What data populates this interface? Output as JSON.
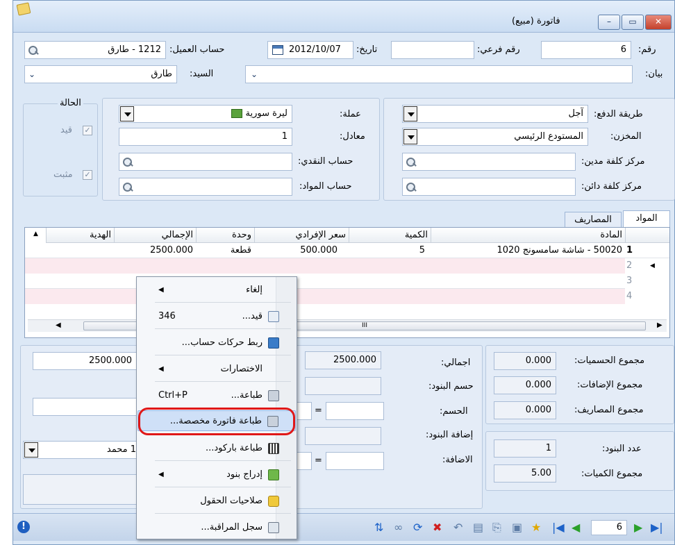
{
  "window": {
    "title": "فاتورة (مبيع)",
    "title_icon": "note-icon",
    "controls": [
      "minimize-icon",
      "restore-icon",
      "close-icon"
    ]
  },
  "header": {
    "number_label": "رقم:",
    "number_value": "6",
    "sub_number_label": "رقم فرعي:",
    "sub_number_value": "",
    "date_label": "تاريخ:",
    "date_value": "2012/10/07",
    "customer_label": "حساب العميل:",
    "customer_value": "1212 - طارق",
    "statement_label": "بيان:",
    "statement_value": "",
    "mr_label": "السيد:",
    "mr_value": "طارق"
  },
  "details": {
    "payment_label": "طريقة الدفع:",
    "payment_value": "آجل",
    "warehouse_label": "المخزن:",
    "warehouse_value": "المستودع الرئيسي",
    "debit_center_label": "مركز كلفة مدين:",
    "credit_center_label": "مركز كلفة دائن:",
    "currency_label": "عملة:",
    "currency_value": "ليرة سورية",
    "rate_label": "معادل:",
    "rate_value": "1",
    "cash_account_label": "حساب النقدي:",
    "materials_account_label": "حساب المواد:",
    "status_title": "الحالة",
    "status_posted": "قيد",
    "status_confirmed": "مثبت"
  },
  "tabs": [
    "المواد",
    "المصاريف"
  ],
  "grid": {
    "columns": [
      "المادة",
      "الكمية",
      "سعر الإفرادي",
      "وحدة",
      "الإجمالي",
      "الهدية"
    ],
    "rows": [
      {
        "num": "1",
        "material": "50020 - شاشة سامسونج 1020",
        "qty": "5",
        "price": "500.000",
        "unit": "قطعة",
        "total": "2500.000",
        "gift": ""
      },
      {
        "num": "2",
        "material": "",
        "qty": "",
        "price": "",
        "unit": "",
        "total": "",
        "gift": ""
      },
      {
        "num": "3",
        "material": "",
        "qty": "",
        "price": "",
        "unit": "",
        "total": "",
        "gift": ""
      },
      {
        "num": "4",
        "material": "",
        "qty": "",
        "price": "",
        "unit": "",
        "total": "",
        "gift": ""
      }
    ],
    "scroll_marker": "III"
  },
  "totals": {
    "discounts_sum_label": "مجموع الحسميات:",
    "discounts_sum_value": "0.000",
    "additions_sum_label": "مجموع الإضافات:",
    "additions_sum_value": "0.000",
    "expenses_sum_label": "مجموع المصاريف:",
    "expenses_sum_value": "0.000",
    "items_count_label": "عدد البنود:",
    "items_count_value": "1",
    "qty_sum_label": "مجموع الكميات:",
    "qty_sum_value": "5.00",
    "total_label": "اجمالي:",
    "total_value": "2500.000",
    "items_discount_label": "حسم البنود:",
    "discount_label": "الحسم:",
    "items_addition_label": "إضافة البنود:",
    "addition_label": "الاضافة:",
    "equals": "=",
    "net_value": "2500.000",
    "salesman_value": "1 محمد"
  },
  "menu": {
    "items": [
      {
        "label": "إلغاء",
        "icon": "",
        "shortcut": "",
        "submenu": true
      },
      {
        "label": "قيد...",
        "icon": "ledger-icon",
        "shortcut": "346",
        "submenu": false
      },
      {
        "label": "ربط حركات حساب...",
        "icon": "link-icon",
        "shortcut": "",
        "submenu": false
      },
      {
        "label": "الاختصارات",
        "icon": "",
        "shortcut": "",
        "submenu": true
      },
      {
        "label": "طباعة...",
        "icon": "printer-icon",
        "shortcut": "Ctrl+P",
        "submenu": false
      },
      {
        "label": "طباعة فاتورة مخصصة...",
        "icon": "printer-icon",
        "shortcut": "",
        "submenu": false,
        "highlighted": true
      },
      {
        "label": "طباعة باركود...",
        "icon": "barcode-icon",
        "shortcut": "",
        "submenu": false
      },
      {
        "label": "إدراج بنود",
        "icon": "insert-rows-icon",
        "shortcut": "",
        "submenu": true
      },
      {
        "label": "صلاحيات الحقول",
        "icon": "lock-icon",
        "shortcut": "",
        "submenu": false
      },
      {
        "label": "سجل المراقبة...",
        "icon": "audit-log-icon",
        "shortcut": "",
        "submenu": false
      }
    ]
  },
  "statusbar": {
    "page_value": "6",
    "info_icon": "info-icon"
  },
  "colors": {
    "highlight_ring": "#e01818",
    "close_button": "#c4412c",
    "menu_highlight": "#cfe0f7"
  }
}
